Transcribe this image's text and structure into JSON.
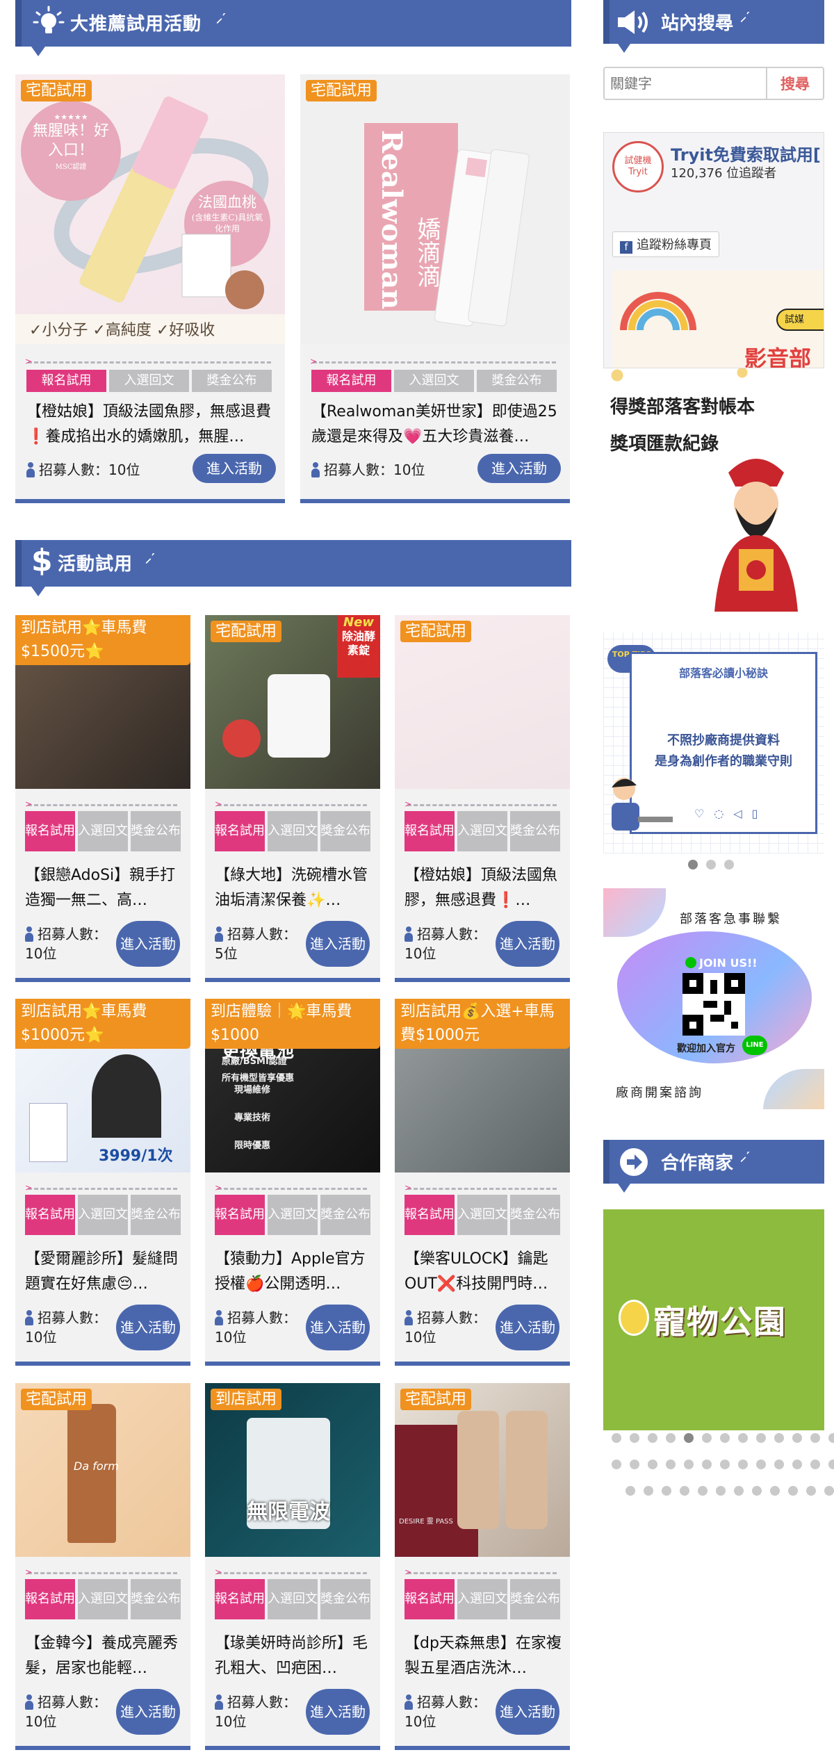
{
  "featured": {
    "title": "大推薦試用活動",
    "cards": [
      {
        "badge": "宅配試用",
        "steps": [
          "報名試用",
          "入選回文",
          "獎金公布"
        ],
        "title": "【橙姑娘】頂級法國魚膠，無感退費❗️養成掐出水的嬌嫩肌，無腥…",
        "recruit": "招募人數：10位",
        "enter": "進入活動",
        "img_text": {
          "bubble_left": "無腥味！好入口！",
          "bubble_left_sub": "MSC認證",
          "bubble_right": "法國血桃",
          "bubble_right_sub": "(含維生素C)具抗氧化作用",
          "bottom": "✓小分子 ✓高純度 ✓好吸收"
        }
      },
      {
        "badge": "宅配試用",
        "steps": [
          "報名試用",
          "入選回文",
          "獎金公布"
        ],
        "title": "【Realwoman美妍世家】即使過25歲還是來得及💗五大珍貴滋養…",
        "recruit": "招募人數：10位",
        "enter": "進入活動",
        "img_text": {
          "brand": "Realwoman",
          "cn": "嬌滴滴"
        }
      }
    ]
  },
  "activity": {
    "title": "活動試用",
    "cards": [
      {
        "badge": "到店試用⭐車馬費$1500元⭐",
        "title": "【銀戀AdoSi】親手打造獨一無二、高…",
        "recruit": "招募人數：10位"
      },
      {
        "badge": "宅配試用",
        "title": "【綠大地】洗碗槽水管油垢清潔保養✨…",
        "recruit": "招募人數：5位",
        "new_tag": "New",
        "new_sub": "除油酵素錠"
      },
      {
        "badge": "宅配試用",
        "title": "【橙姑娘】頂級法國魚膠，無感退費❗…",
        "recruit": "招募人數：10位"
      },
      {
        "badge": "到店試用⭐車馬費$1000元⭐",
        "title": "【愛爾麗診所】髮縫問題實在好焦慮😔…",
        "recruit": "招募人數：10位",
        "price": "3999/1次"
      },
      {
        "badge": "到店體驗｜🌟車馬費$1000",
        "title": "【猿動力】Apple官方授權🍎公開透明…",
        "recruit": "招募人數：10位",
        "img_lines": [
          "更換電池",
          "原廠/BSMI認證",
          "所有機型皆享優惠",
          "現場維修",
          "專業技術",
          "限時優惠"
        ]
      },
      {
        "badge": "到店試用💰入選+車馬費$1000元",
        "title": "【樂客ULOCK】鑰匙OUT❌科技開門時…",
        "recruit": "招募人數：10位"
      },
      {
        "badge": "宅配試用",
        "title": "【金韓今】養成亮麗秀髮，居家也能輕…",
        "recruit": "招募人數：10位",
        "brand": "Da form"
      },
      {
        "badge": "到店試用",
        "title": "【瑑美妍時尚診所】毛孔粗大、凹疤困…",
        "recruit": "招募人數：10位",
        "img_big": "無限電波"
      },
      {
        "badge": "宅配試用",
        "title": "【dp天森無患】在家複製五星酒店洗沐…",
        "recruit": "招募人數：10位",
        "img_small": "DESIRE 靈 PASS"
      }
    ],
    "steps": [
      "報名試用",
      "入選回文",
      "獎金公布"
    ],
    "enter": "進入活動"
  },
  "sidebar": {
    "search_title": "站內搜尋",
    "search_placeholder": "關鍵字",
    "search_button": "搜尋",
    "fb_name": "Tryit免費索取試用[",
    "fb_followers": "120,376 位追蹤者",
    "fb_follow": "追蹤粉絲專頁",
    "fb_logo": "試健機 Tryit",
    "banner_tag": "試媒",
    "banner_video": "影音部",
    "ledger_line1": "得獎部落客對帳本",
    "ledger_line2": "獎項匯款紀錄",
    "tips_badge": "TOP TIPS",
    "tips_heading": "部落客必讀小秘訣",
    "tips_line1": "不照抄廠商提供資料",
    "tips_line2": "是身為創作者的職業守則",
    "contact_top": "部落客急事聯繫",
    "contact_join": "JOIN US!!",
    "contact_caption": "歡迎加入官方",
    "contact_line": "LINE",
    "contact_bottom": "廠商開案諮詢",
    "partners_title": "合作商家",
    "partner_name": "寵物公園"
  },
  "colors": {
    "accent": "#4a67ae",
    "orange": "#f0921f",
    "pink": "#e0387f",
    "grey": "#bfbfc2",
    "green": "#8dbb3d"
  }
}
